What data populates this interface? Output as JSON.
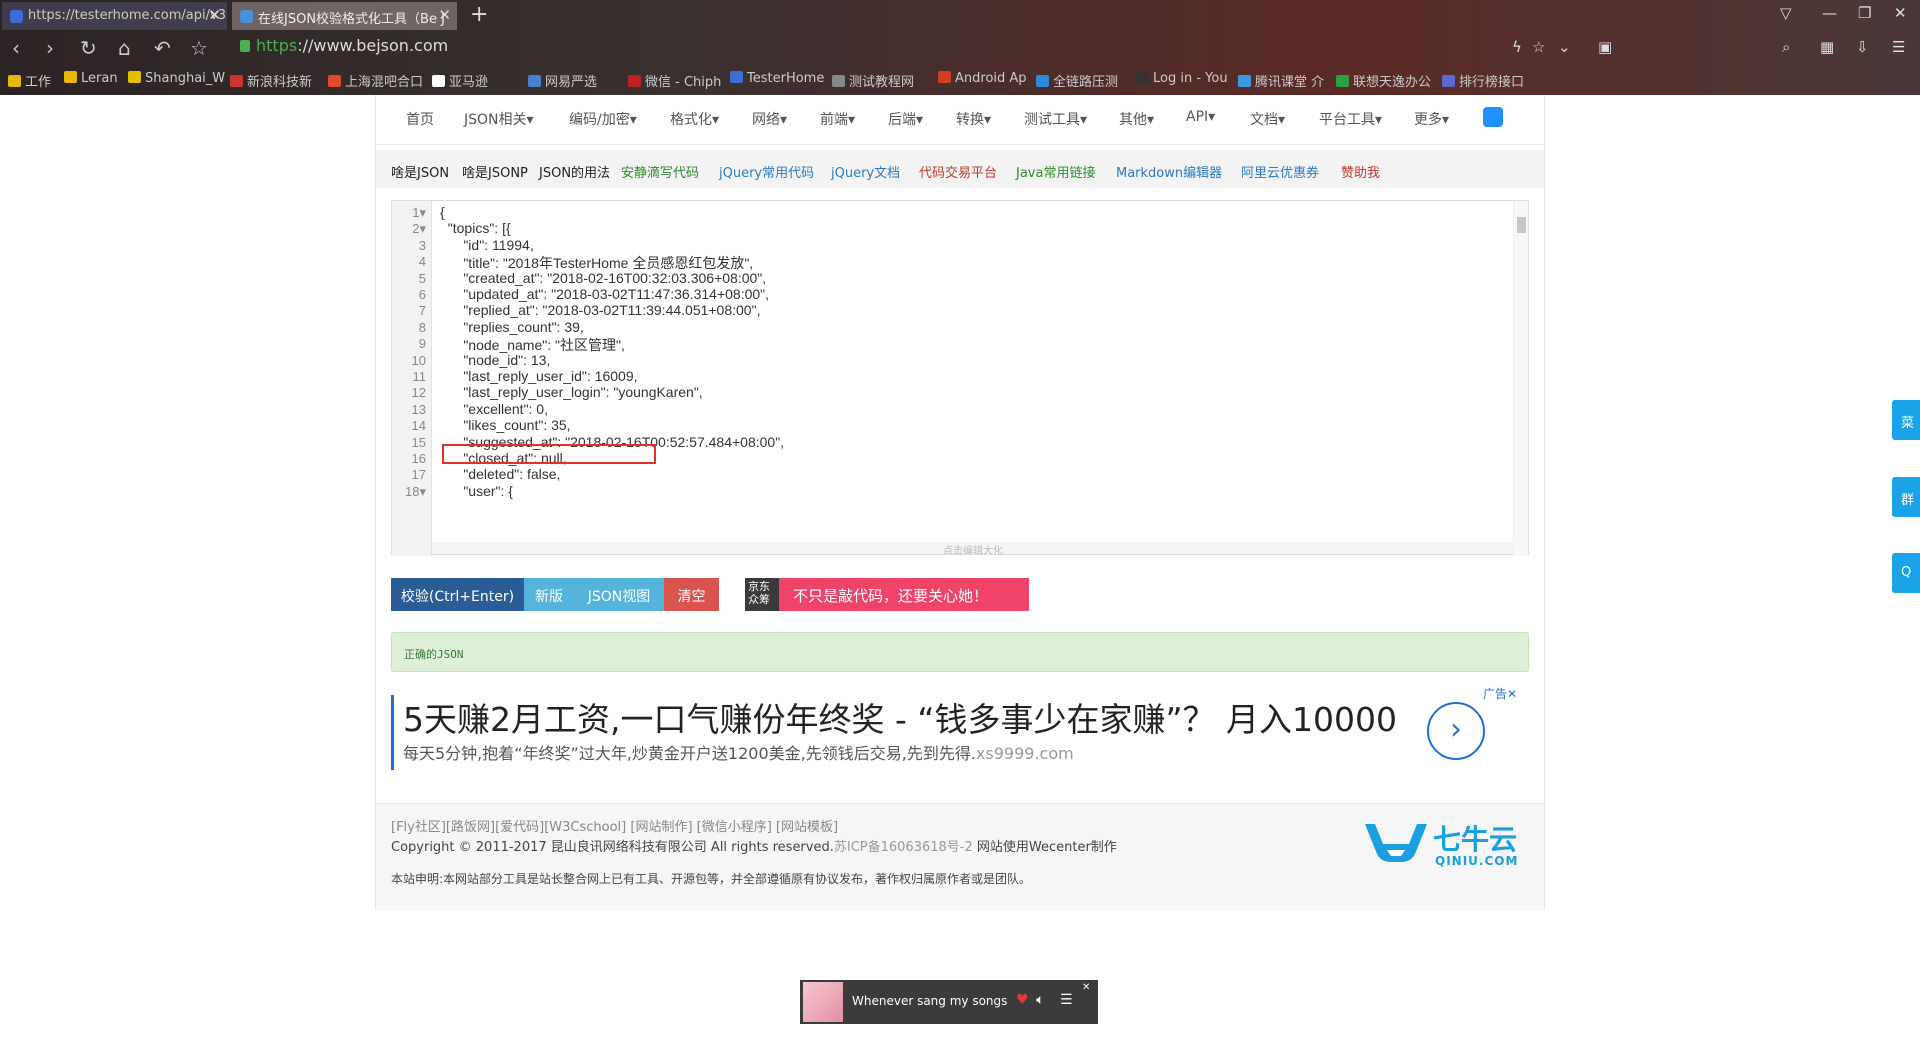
{
  "browser": {
    "tabs": [
      {
        "title": "https://testerhome.com/api/v3",
        "active": false
      },
      {
        "title": "在线JSON校验格式化工具（Be J",
        "active": true
      }
    ],
    "url_scheme": "https",
    "url_rest": "://www.bejson.com",
    "bookmarks": [
      "工作",
      "Leran",
      "Shanghai_W",
      "新浪科技新",
      "上海混吧合口",
      "亚马逊",
      "网易严选",
      "微信 - Chiph",
      "TesterHome",
      "测试教程网",
      "Android Ap",
      "全链路压测",
      "Log in - You",
      "腾讯课堂 介",
      "联想天逸办公",
      "排行榜接口"
    ]
  },
  "topnav": [
    "首页",
    "JSON相关▾",
    "编码/加密▾",
    "格式化▾",
    "网络▾",
    "前端▾",
    "后端▾",
    "转换▾",
    "测试工具▾",
    "其他▾",
    "API▾",
    "文档▾",
    "平台工具▾",
    "更多▾"
  ],
  "subnav": [
    {
      "label": "啥是JSON",
      "color": "#222"
    },
    {
      "label": "啥是JSONP",
      "color": "#222"
    },
    {
      "label": "JSON的用法",
      "color": "#222"
    },
    {
      "label": "安静滴写代码",
      "color": "#2e8b2e"
    },
    {
      "label": "jQuery常用代码",
      "color": "#2a7ac8"
    },
    {
      "label": "jQuery文档",
      "color": "#2a7ac8"
    },
    {
      "label": "代码交易平台",
      "color": "#c0392b"
    },
    {
      "label": "Java常用链接",
      "color": "#2e8b2e"
    },
    {
      "label": "Markdown编辑器",
      "color": "#2a7ac8"
    },
    {
      "label": "阿里云优惠券",
      "color": "#2a7ac8"
    },
    {
      "label": "赞助我",
      "color": "#c0392b"
    }
  ],
  "editor": {
    "lines": [
      {
        "n": "1▾",
        "text": "{"
      },
      {
        "n": "2▾",
        "text": "  \"topics\": [{"
      },
      {
        "n": "3",
        "text": "      \"id\": 11994,"
      },
      {
        "n": "4",
        "text": "      \"title\": \"2018年TesterHome 全员感恩红包发放\","
      },
      {
        "n": "5",
        "text": "      \"created_at\": \"2018-02-16T00:32:03.306+08:00\","
      },
      {
        "n": "6",
        "text": "      \"updated_at\": \"2018-03-02T11:47:36.314+08:00\","
      },
      {
        "n": "7",
        "text": "      \"replied_at\": \"2018-03-02T11:39:44.051+08:00\","
      },
      {
        "n": "8",
        "text": "      \"replies_count\": 39,"
      },
      {
        "n": "9",
        "text": "      \"node_name\": \"社区管理\","
      },
      {
        "n": "10",
        "text": "      \"node_id\": 13,"
      },
      {
        "n": "11",
        "text": "      \"last_reply_user_id\": 16009,"
      },
      {
        "n": "12",
        "text": "      \"last_reply_user_login\": \"youngKaren\","
      },
      {
        "n": "13",
        "text": "      \"excellent\": 0,"
      },
      {
        "n": "14",
        "text": "      \"likes_count\": 35,"
      },
      {
        "n": "15",
        "text": "      \"suggested_at\": \"2018-02-16T00:52:57.484+08:00\","
      },
      {
        "n": "16",
        "text": "      \"closed_at\": null,"
      },
      {
        "n": "17",
        "text": "      \"deleted\": false,"
      },
      {
        "n": "18▾",
        "text": "      \"user\": {"
      }
    ],
    "hscroll_hint": "点击编辑大化"
  },
  "buttons": {
    "validate": "校验(Ctrl+Enter)",
    "new_version": "新版",
    "json_view": "JSON视图",
    "clear": "清空",
    "jd_label": "京东众筹",
    "promo": "不只是敲代码，还要关心她！"
  },
  "result": "正确的JSON",
  "ad": {
    "headline": "5天赚2月工资,一口气赚份年终奖 - “钱多事少在家赚”？ 月入10000",
    "desc": "每天5分钟,抱着“年终奖”过大年,炒黄金开户送1200美金,先领钱后交易,先到先得.",
    "domain": "xs9999.com",
    "label": "广告✕"
  },
  "footer": {
    "links": "[Fly社区][路饭网][爱代码][W3Cschool] [网站制作] [微信小程序] [网站模板]",
    "copyright": "Copyright © 2011-2017 昆山良讯网络科技有限公司 All rights reserved.",
    "icp": "苏ICP备16063618号-2",
    "powered": " 网站使用Wecenter制作",
    "note": "本站申明:本网站部分工具是站长整合网上已有工具、开源包等，并全部遵循原有协议发布，著作权归属原作者或是团队。",
    "logo_brand": "七牛云",
    "logo_sub": "QINIU.COM"
  },
  "side_tabs": [
    "菜",
    "群",
    "Q"
  ],
  "player": {
    "song": "Whenever sang my songs"
  }
}
